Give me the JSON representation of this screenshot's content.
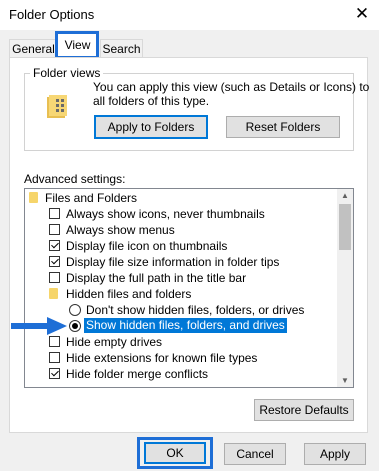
{
  "window": {
    "title": "Folder Options",
    "close_glyph": "✕"
  },
  "tabs": {
    "general": "General",
    "view": "View",
    "search": "Search"
  },
  "folder_views": {
    "label": "Folder views",
    "desc_line1": "You can apply this view (such as Details or Icons) to",
    "desc_line2": "all folders of this type.",
    "apply_label": "Apply to Folders",
    "reset_label": "Reset Folders"
  },
  "advanced": {
    "label": "Advanced settings:",
    "items": [
      {
        "type": "folder",
        "label": "Files and Folders"
      },
      {
        "type": "checkbox",
        "checked": false,
        "label": "Always show icons, never thumbnails"
      },
      {
        "type": "checkbox",
        "checked": false,
        "label": "Always show menus"
      },
      {
        "type": "checkbox",
        "checked": true,
        "label": "Display file icon on thumbnails"
      },
      {
        "type": "checkbox",
        "checked": true,
        "label": "Display file size information in folder tips"
      },
      {
        "type": "checkbox",
        "checked": false,
        "label": "Display the full path in the title bar"
      },
      {
        "type": "folder",
        "label": "Hidden files and folders"
      },
      {
        "type": "radio",
        "checked": false,
        "label": "Don't show hidden files, folders, or drives"
      },
      {
        "type": "radio",
        "checked": true,
        "selected": true,
        "label": "Show hidden files, folders, and drives"
      },
      {
        "type": "checkbox",
        "checked": false,
        "label": "Hide empty drives"
      },
      {
        "type": "checkbox",
        "checked": false,
        "label": "Hide extensions for known file types"
      },
      {
        "type": "checkbox",
        "checked": true,
        "label": "Hide folder merge conflicts"
      }
    ],
    "restore_label": "Restore Defaults"
  },
  "buttons": {
    "ok": "OK",
    "cancel": "Cancel",
    "apply": "Apply"
  },
  "colors": {
    "accent": "#1e6ed6",
    "selection": "#0078d7"
  }
}
